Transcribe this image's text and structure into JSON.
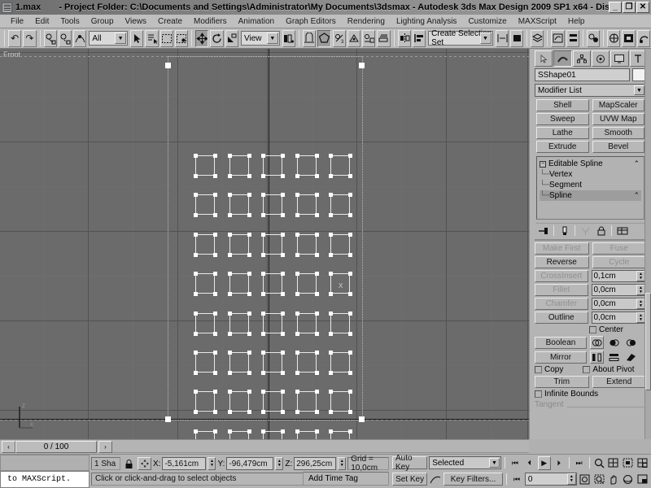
{
  "window": {
    "filename": "1.max",
    "title": "- Project Folder: C:\\Documents and Settings\\Administrator\\My Documents\\3dsmax     - Autodesk 3ds Max Design 2009 SP1  x64            - Dis...",
    "minimize": "_",
    "restore": "❐",
    "close": "✕"
  },
  "menu": {
    "items": [
      "File",
      "Edit",
      "Tools",
      "Group",
      "Views",
      "Create",
      "Modifiers",
      "Animation",
      "Graph Editors",
      "Rendering",
      "Lighting Analysis",
      "Customize",
      "MAXScript",
      "Help"
    ]
  },
  "toolbar": {
    "undo_icon": "↶",
    "redo_icon": "↷",
    "select_link_icon": "link-icon",
    "unlink_icon": "unlink-icon",
    "bind_space_warp_icon": "bind-icon",
    "selection_filter": "All",
    "select_object_icon": "▶",
    "select_by_name_icon": "name-icon",
    "select_region_icon": "region-icon",
    "window_crossing_icon": "crossing-icon",
    "select_move_icon": "✛",
    "select_rotate_icon": "↻",
    "select_scale_icon": "scale-icon",
    "ref_coord_system": "View",
    "use_center_icon": "center-icon",
    "snap_toggle_icon": "snap-icon",
    "angle_snap_icon": "angle-icon",
    "percent_snap_icon": "percent-icon",
    "spinner_snap_icon": "spinner-icon",
    "named_selection_icon": "named-sel-icon",
    "selection_set": "Create Selection Set",
    "mirror_icon": "mirror-icon",
    "align_icon": "align-icon",
    "layer_manager_icon": "layers-icon",
    "curve_editor_icon": "curve-icon",
    "schematic_icon": "schematic-icon",
    "material_editor_icon": "material-icon",
    "render_setup_icon": "render-setup-icon",
    "render_frame_icon": "render-frame-icon",
    "render_icon": "render-icon"
  },
  "viewport": {
    "label": "Front",
    "axis_gizmo": {
      "z": "Z",
      "x": "X"
    },
    "cursor_label": "X",
    "shape_grid": {
      "rows": 8,
      "cols": 5
    }
  },
  "command_panel": {
    "tabs": [
      {
        "name": "create",
        "icon": "↖"
      },
      {
        "name": "modify",
        "icon": "◜"
      },
      {
        "name": "hierarchy",
        "icon": "⛓"
      },
      {
        "name": "motion",
        "icon": "◎"
      },
      {
        "name": "display",
        "icon": "▣"
      },
      {
        "name": "utilities",
        "icon": "⚒"
      }
    ],
    "selected_tab": 1,
    "object_name": "SShape01",
    "modifier_list": "Modifier List",
    "modifier_buttons": [
      "Shell",
      "MapScaler",
      "Sweep",
      "UVW Map",
      "Lathe",
      "Smooth",
      "Extrude",
      "Bevel"
    ],
    "stack": {
      "root": "Editable Spline",
      "sub_objects": [
        "Vertex",
        "Segment",
        "Spline"
      ],
      "selected_sub_object": "Spline"
    },
    "stack_tools": [
      "pin-stack-icon",
      "show-end-result-icon",
      "make-unique-icon",
      "remove-modifier-icon",
      "configure-sets-icon"
    ],
    "geometry": {
      "buttons_row1": [
        "Make First",
        "Fuse"
      ],
      "buttons_row2": [
        "Reverse",
        "Cycle"
      ],
      "crossinsert_label": "CrossInsert",
      "crossinsert_value": "0,1cm",
      "fillet_label": "Fillet",
      "fillet_value": "0,0cm",
      "chamfer_label": "Chamfer",
      "chamfer_value": "0,0cm",
      "outline_label": "Outline",
      "outline_value": "0,0cm",
      "center_label": "Center",
      "boolean_label": "Boolean",
      "boolean_icons": [
        "union-icon",
        "subtraction-icon",
        "intersection-icon"
      ],
      "mirror_label": "Mirror",
      "mirror_icons": [
        "mirror-horizontal-icon",
        "mirror-vertical-icon",
        "mirror-both-icon"
      ],
      "copy_label": "Copy",
      "about_pivot_label": "About Pivot",
      "trim_label": "Trim",
      "extend_label": "Extend",
      "infinite_bounds_label": "Infinite Bounds",
      "tangent_group_label": "Tangent"
    }
  },
  "time_slider": {
    "prev_arrow": "‹",
    "label": "0 / 100",
    "next_arrow": "›"
  },
  "listener": {
    "text": "to MAXScript."
  },
  "status": {
    "selection_count": "1 Sha",
    "lock_icon": "lock-icon",
    "absolute_mode_icon": "absolute-icon",
    "x_label": "X:",
    "x_value": "-5,161cm",
    "y_label": "Y:",
    "y_value": "-96,479cm",
    "z_label": "Z:",
    "z_value": "296,25cm",
    "grid_label": "Grid = 10,0cm",
    "prompt": "Click or click-and-drag to select objects",
    "add_time_tag": "Add Time Tag",
    "key_mode_icon": "key-mode-icon"
  },
  "animation": {
    "auto_key": "Auto Key",
    "set_key": "Set Key",
    "key_filters": "Key Filters...",
    "selection_level": "Selected",
    "curve_icon": "curve-icon",
    "frame_value": "0",
    "transport": {
      "go_to_start": "⏮",
      "prev_frame": "⏴",
      "play": "▶",
      "next_frame": "⏵",
      "go_to_end": "⏭",
      "key_mode": "⏮"
    },
    "nav_icons": [
      "zoom-icon",
      "zoom-all-icon",
      "zoom-extents-icon",
      "zoom-region-icon",
      "field-of-view-icon",
      "maximize-viewport-icon",
      "pan-icon",
      "arc-rotate-icon",
      "min-max-toggle-icon"
    ]
  }
}
